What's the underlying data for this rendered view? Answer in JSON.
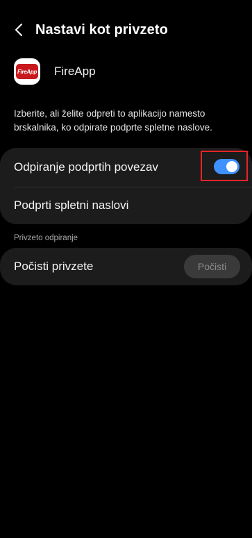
{
  "header": {
    "title": "Nastavi kot privzeto",
    "back_icon": "chevron-left-icon"
  },
  "app": {
    "name": "FireApp",
    "icon_text": "FireApp"
  },
  "description": "Izberite, ali želite odpreti to aplikacijo namesto brskalnika, ko odpirate podprte spletne naslove.",
  "links_card": {
    "open_supported_label": "Odpiranje podprtih povezav",
    "open_supported_enabled": true,
    "supported_addresses_label": "Podprti spletni naslovi"
  },
  "default_opening": {
    "section_label": "Privzeto odpiranje",
    "clear_label": "Počisti privzete",
    "clear_button_label": "Počisti"
  },
  "colors": {
    "background": "#000000",
    "card": "#1c1c1c",
    "toggle_on": "#3e91ff",
    "highlight": "#e8232a",
    "app_icon_red": "#c8191e"
  }
}
